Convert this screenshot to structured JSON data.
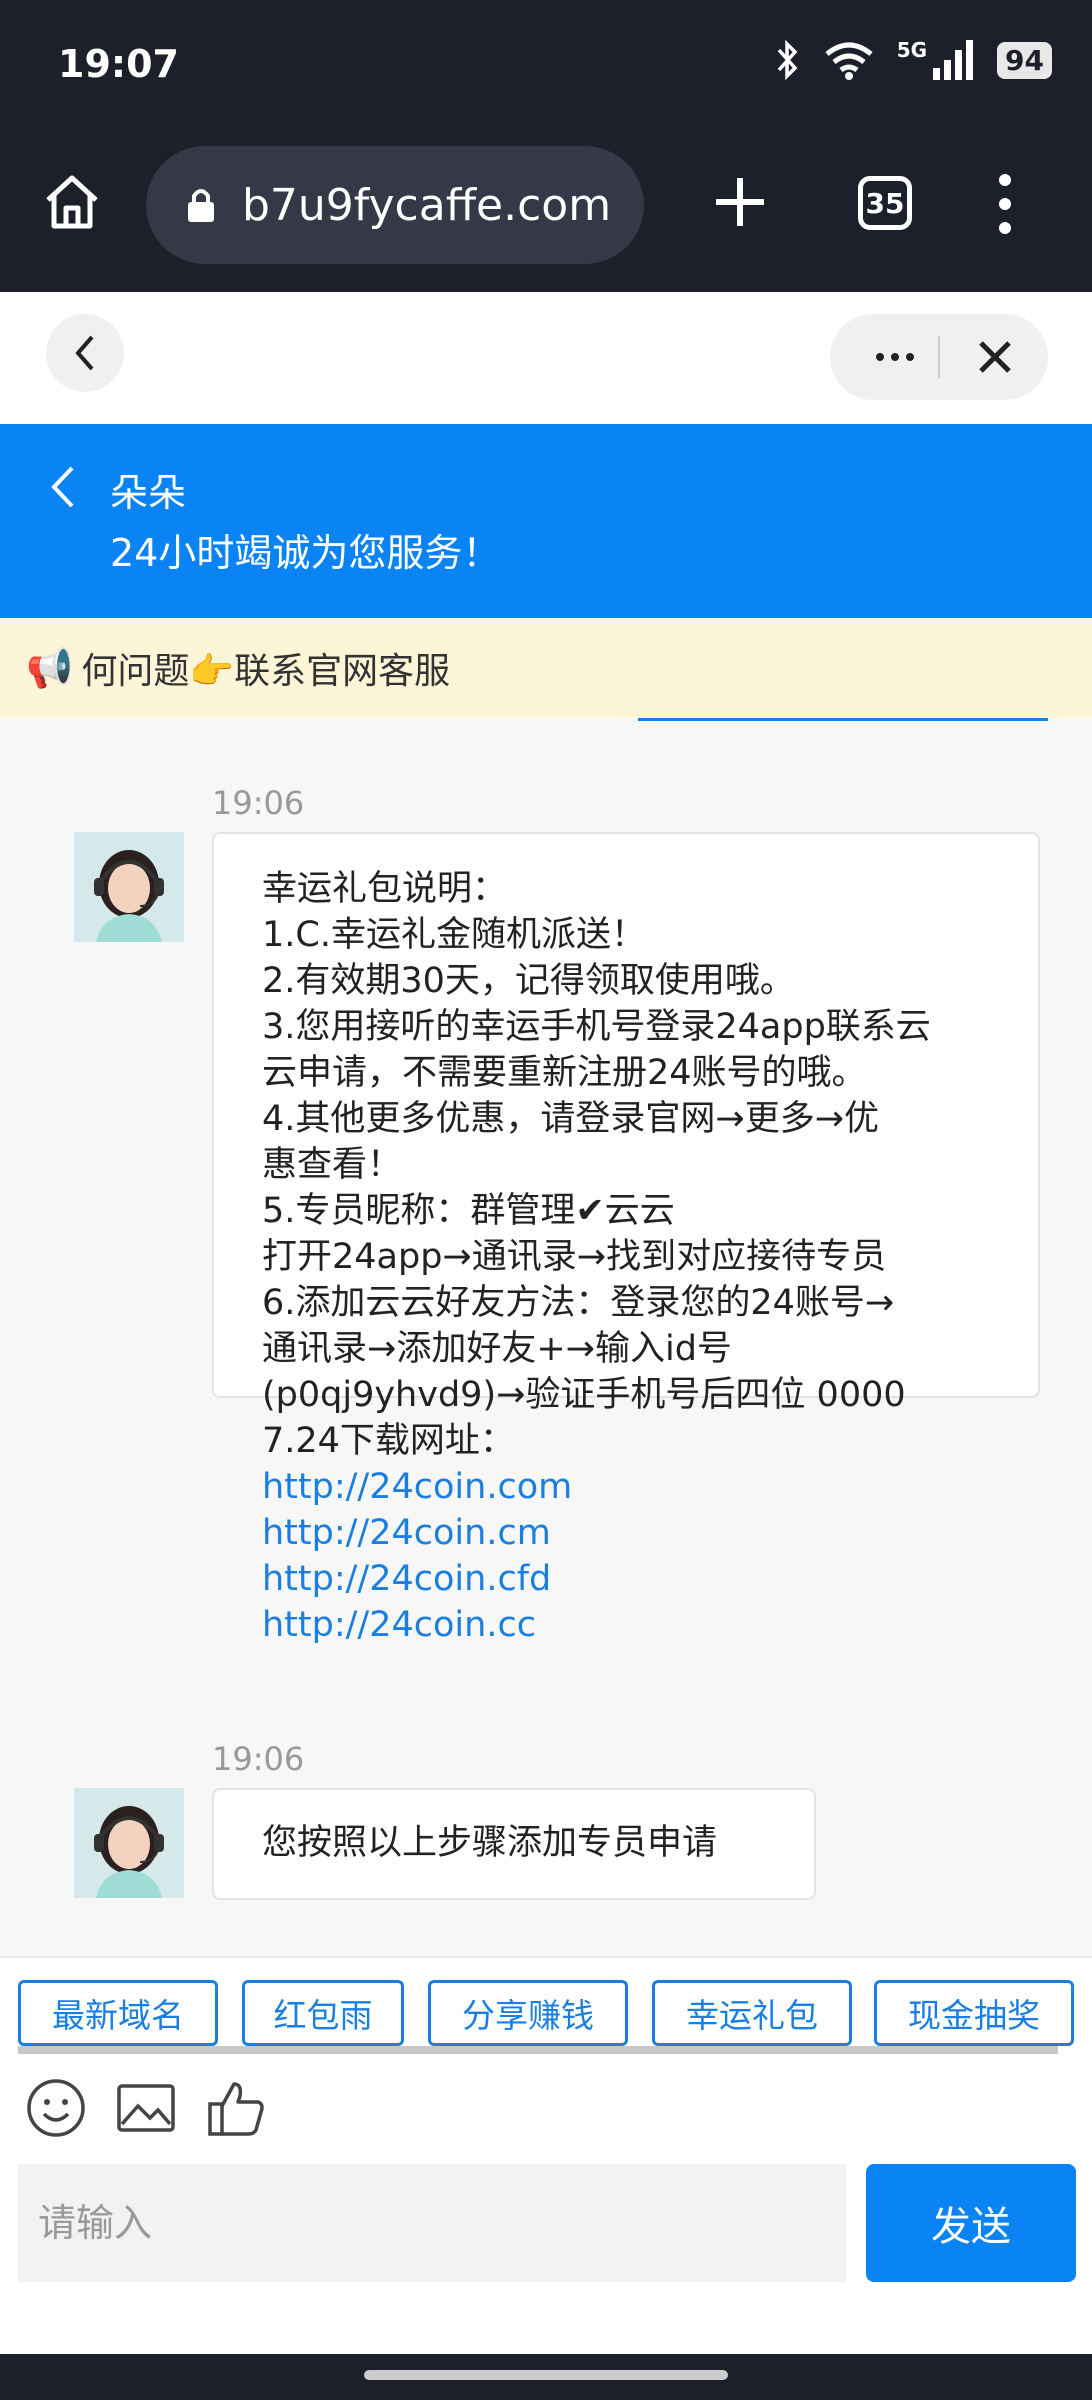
{
  "status_bar": {
    "time": "19:07",
    "network": "5G",
    "battery": "94"
  },
  "browser": {
    "url": "b7u9fycaffe.com",
    "tab_count": "35"
  },
  "chat_header": {
    "name": "朵朵",
    "subtitle": "24小时竭诚为您服务！"
  },
  "notice": {
    "text": "何问题👉联系官网客服"
  },
  "messages": [
    {
      "time": "19:06",
      "lines": [
        "幸运礼包说明：",
        "1.C.幸运礼金随机派送！",
        "2.有效期30天，记得领取使用哦。",
        "3.您用接听的幸运手机号登录24app联系云",
        "云申请，不需要重新注册24账号的哦。",
        "4.其他更多优惠，请登录官网→更多→优",
        "惠查看！",
        "5.专员昵称：群管理✔云云",
        "打开24app→通讯录→找到对应接待专员",
        "6.添加云云好友方法：登录您的24账号→",
        "通讯录→添加好友+→输入id号",
        "(p0qj9yhvd9)→验证手机号后四位 0000",
        "7.24下载网址："
      ],
      "links": [
        "http://24coin.com",
        "http://24coin.cm",
        "http://24coin.cfd",
        "http://24coin.cc"
      ]
    },
    {
      "time": "19:06",
      "text": "您按照以上步骤添加专员申请"
    }
  ],
  "quick_buttons": [
    "最新域名",
    "红包雨",
    "分享赚钱",
    "幸运礼包",
    "现金抽奖"
  ],
  "input": {
    "placeholder": "请输入",
    "send_label": "发送"
  },
  "colors": {
    "brand_blue": "#0a84f5",
    "link_blue": "#1a7fe0",
    "notice_bg": "#fdf5d8",
    "dark_chrome": "#1d1f2b"
  }
}
